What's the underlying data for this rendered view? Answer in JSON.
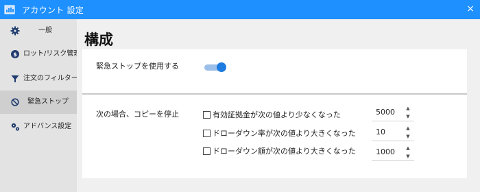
{
  "window": {
    "title": "アカウント 設定",
    "close_label": "×"
  },
  "sidebar": {
    "items": [
      {
        "label": "一般",
        "icon": "gear-icon"
      },
      {
        "label": "ロット/リスク管理",
        "icon": "dollar-icon"
      },
      {
        "label": "注文のフィルター",
        "icon": "filter-icon"
      },
      {
        "label": "緊急ストップ",
        "icon": "prohibited-icon"
      },
      {
        "label": "アドバンス設定",
        "icon": "advanced-gears-icon"
      }
    ],
    "active_index": 3
  },
  "main": {
    "heading": "構成",
    "emergency_stop": {
      "label": "緊急ストップを使用する",
      "enabled": true
    },
    "stop_copy": {
      "label": "次の場合、コピーを停止",
      "conditions": [
        {
          "label": "有効証拠金が次の値より少なくなった",
          "checked": false,
          "value": "5000"
        },
        {
          "label": "ドローダウン率が次の値より大きくなった",
          "checked": false,
          "value": "10"
        },
        {
          "label": "ドローダウン額が次の値より大きくなった",
          "checked": false,
          "value": "1000"
        }
      ]
    }
  },
  "colors": {
    "accent": "#1e90ff",
    "toggle_on": "#1e7be0",
    "sidebar_bg": "#e3e3e3",
    "active_item_bg": "#cfcfcf"
  }
}
